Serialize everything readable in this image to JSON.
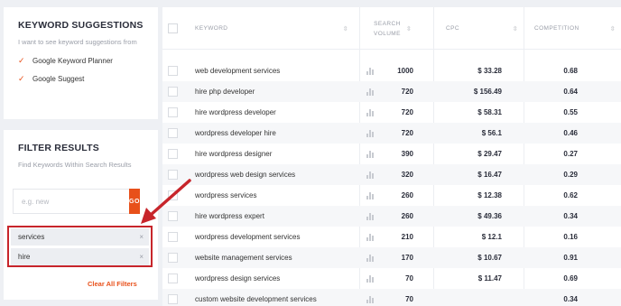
{
  "suggestions": {
    "title": "KEYWORD SUGGESTIONS",
    "description": "I want to see keyword suggestions from",
    "options": [
      {
        "label": "Google Keyword Planner",
        "check": "✓"
      },
      {
        "label": "Google Suggest",
        "check": "✓"
      }
    ]
  },
  "filter": {
    "title": "FILTER RESULTS",
    "description": "Find Keywords Within Search Results",
    "placeholder": "e.g. new",
    "go_label": "GO",
    "tags": [
      {
        "label": "services",
        "remove": "×"
      },
      {
        "label": "hire",
        "remove": "×"
      }
    ],
    "clear_label": "Clear All Filters"
  },
  "table": {
    "headers": {
      "keyword": "KEYWORD",
      "volume_line1": "SEARCH",
      "volume_line2": "VOLUME",
      "cpc": "CPC",
      "competition": "COMPETITION",
      "sort": "⇳"
    },
    "rows": [
      {
        "keyword": "web development services",
        "volume": "1000",
        "cpc": "$ 33.28",
        "competition": "0.68"
      },
      {
        "keyword": "hire php developer",
        "volume": "720",
        "cpc": "$ 156.49",
        "competition": "0.64"
      },
      {
        "keyword": "hire wordpress developer",
        "volume": "720",
        "cpc": "$ 58.31",
        "competition": "0.55"
      },
      {
        "keyword": "wordpress developer hire",
        "volume": "720",
        "cpc": "$ 56.1",
        "competition": "0.46"
      },
      {
        "keyword": "hire wordpress designer",
        "volume": "390",
        "cpc": "$ 29.47",
        "competition": "0.27"
      },
      {
        "keyword": "wordpress web design services",
        "volume": "320",
        "cpc": "$ 16.47",
        "competition": "0.29"
      },
      {
        "keyword": "wordpress services",
        "volume": "260",
        "cpc": "$ 12.38",
        "competition": "0.62"
      },
      {
        "keyword": "hire wordpress expert",
        "volume": "260",
        "cpc": "$ 49.36",
        "competition": "0.34"
      },
      {
        "keyword": "wordpress development services",
        "volume": "210",
        "cpc": "$ 12.1",
        "competition": "0.16"
      },
      {
        "keyword": "website management services",
        "volume": "170",
        "cpc": "$ 10.67",
        "competition": "0.91"
      },
      {
        "keyword": "wordpress design services",
        "volume": "70",
        "cpc": "$ 11.47",
        "competition": "0.69"
      },
      {
        "keyword": "custom website development services",
        "volume": "70",
        "cpc": "",
        "competition": "0.34"
      }
    ]
  },
  "colors": {
    "accent": "#e8501a",
    "highlight": "#c7252b"
  }
}
